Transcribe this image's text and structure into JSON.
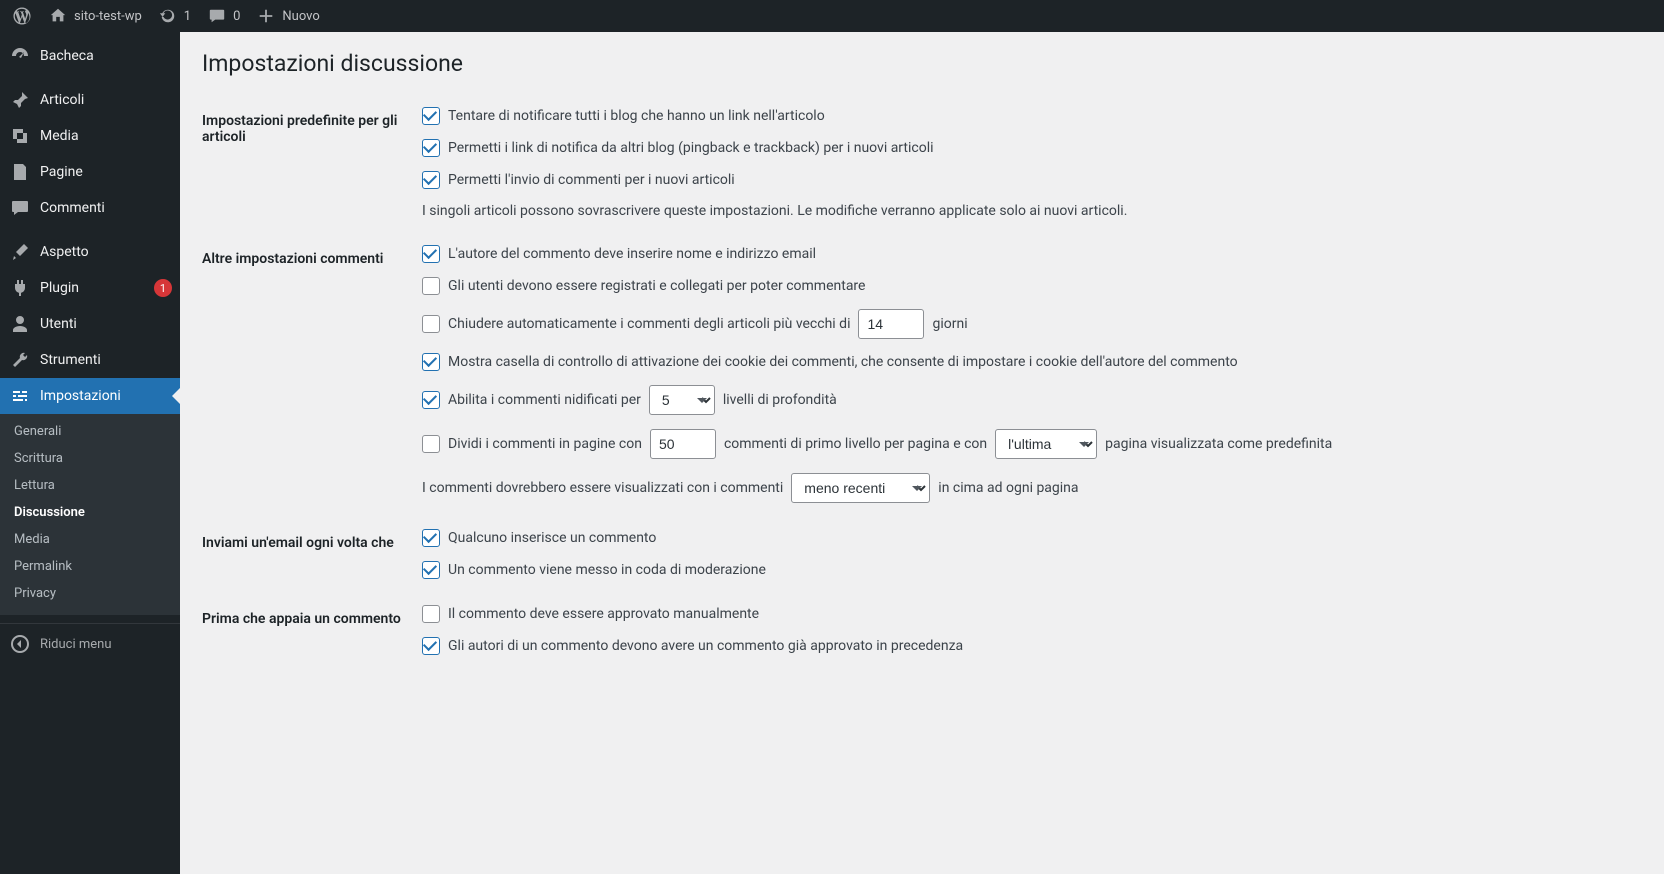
{
  "adminbar": {
    "site_name": "sito-test-wp",
    "updates_count": "1",
    "comments_count": "0",
    "new_label": "Nuovo"
  },
  "menu": {
    "dashboard": "Bacheca",
    "posts": "Articoli",
    "media": "Media",
    "pages": "Pagine",
    "comments": "Commenti",
    "appearance": "Aspetto",
    "plugins": "Plugin",
    "plugin_badge": "1",
    "users": "Utenti",
    "tools": "Strumenti",
    "settings": "Impostazioni",
    "collapse": "Riduci menu"
  },
  "submenu": {
    "general": "Generali",
    "writing": "Scrittura",
    "reading": "Lettura",
    "discussion": "Discussione",
    "media": "Media",
    "permalink": "Permalink",
    "privacy": "Privacy"
  },
  "page": {
    "title": "Impostazioni discussione"
  },
  "s1": {
    "heading": "Impostazioni predefinite per gli articoli",
    "opt1": "Tentare di notificare tutti i blog che hanno un link nell'articolo",
    "opt2": "Permetti i link di notifica da altri blog (pingback e trackback) per i nuovi articoli",
    "opt3": "Permetti l'invio di commenti per i nuovi articoli",
    "note": "I singoli articoli possono sovrascrivere queste impostazioni. Le modifiche verranno applicate solo ai nuovi articoli."
  },
  "s2": {
    "heading": "Altre impostazioni commenti",
    "opt1": "L'autore del commento deve inserire nome e indirizzo email",
    "opt2": "Gli utenti devono essere registrati e collegati per poter commentare",
    "opt3a": "Chiudere automaticamente i commenti degli articoli più vecchi di",
    "close_days": "14",
    "opt3b": "giorni",
    "opt4": "Mostra casella di controllo di attivazione dei cookie dei commenti, che consente di impostare i cookie dell'autore del commento",
    "opt5a": "Abilita i commenti nidificati per",
    "nest_levels": "5",
    "opt5b": "livelli di profondità",
    "opt6a": "Dividi i commenti in pagine con",
    "per_page": "50",
    "opt6b": "commenti di primo livello per pagina e con",
    "page_default": "l'ultima",
    "opt6c": "pagina visualizzata come predefinita",
    "opt7a": "I commenti dovrebbero essere visualizzati con i commenti",
    "order": "meno recenti",
    "opt7b": "in cima ad ogni pagina"
  },
  "s3": {
    "heading": "Inviami un'email ogni volta che",
    "opt1": "Qualcuno inserisce un commento",
    "opt2": "Un commento viene messo in coda di moderazione"
  },
  "s4": {
    "heading": "Prima che appaia un commento",
    "opt1": "Il commento deve essere approvato manualmente",
    "opt2": "Gli autori di un commento devono avere un commento già approvato in precedenza"
  }
}
